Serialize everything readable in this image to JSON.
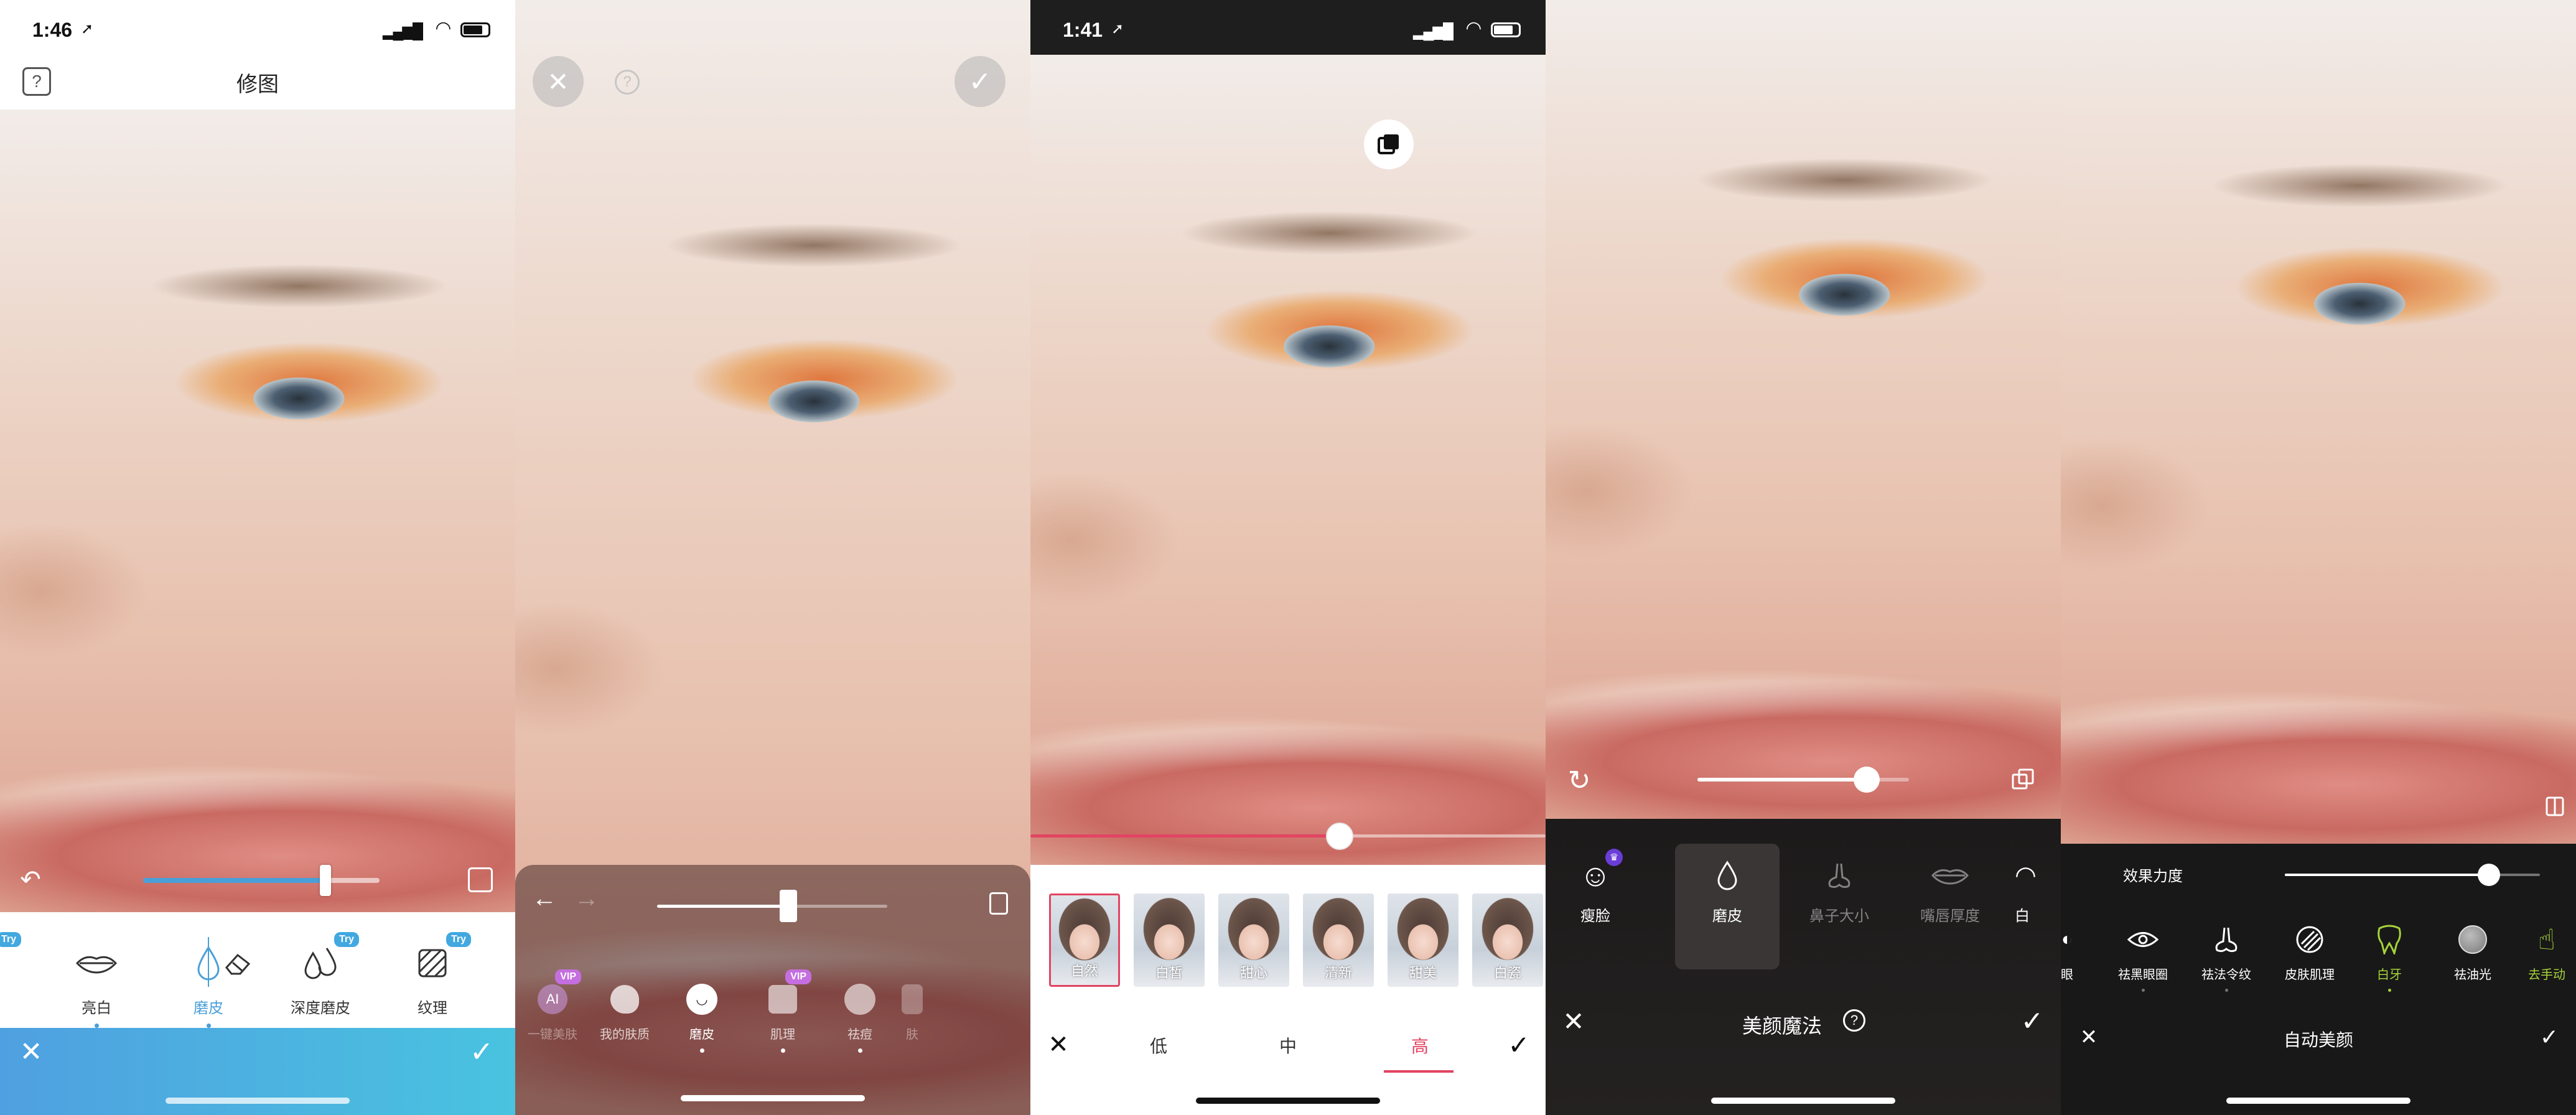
{
  "panel1": {
    "status": {
      "time": "1:46",
      "time_arrow": "➚"
    },
    "header": {
      "title": "修图",
      "help_icon": "?"
    },
    "slider": {
      "value": 0.77
    },
    "tools": [
      {
        "label": "亮白",
        "icon": "lips-icon",
        "try": false
      },
      {
        "label": "磨皮",
        "icon": "droplet-icon",
        "try": false
      },
      {
        "label": "",
        "icon": "eraser-icon",
        "try": false
      },
      {
        "label": "深度磨皮",
        "icon": "double-droplet-icon",
        "try": true
      },
      {
        "label": "纹理",
        "icon": "texture-icon",
        "try": true
      }
    ],
    "try_badge": "Try",
    "try_badge_left": "Try",
    "accent": "#4a9fd8",
    "bottom_gradient": [
      "#4fa0e0",
      "#49c3e0"
    ]
  },
  "panel2": {
    "slider": {
      "value": 0.57
    },
    "tools": [
      {
        "label": "一键美肤",
        "badge": "VIP",
        "icon": "ai-icon",
        "dimmed": true
      },
      {
        "label": "我的肤质",
        "badge": "",
        "icon": "face-profile-icon",
        "dimmed": false
      },
      {
        "label": "磨皮",
        "badge": "",
        "icon": "face-smile-icon",
        "active": true
      },
      {
        "label": "肌理",
        "badge": "VIP",
        "icon": "texture-icon",
        "dimmed": false
      },
      {
        "label": "祛痘",
        "badge": "",
        "icon": "acne-icon",
        "dimmed": false
      },
      {
        "label": "肤",
        "badge": "",
        "icon": "skin-icon",
        "dimmed": true
      }
    ],
    "vip_color": "#c56ee0"
  },
  "panel3": {
    "status": {
      "time": "1:41",
      "time_arrow": "➚"
    },
    "slider": {
      "value": 0.6
    },
    "filters": [
      "自然",
      "白皙",
      "甜心",
      "清新",
      "甜美",
      "白瓷"
    ],
    "levels": [
      "低",
      "中",
      "高"
    ],
    "active_level": "高",
    "accent": "#e24462"
  },
  "panel4": {
    "slider": {
      "value": 0.8
    },
    "tools": [
      {
        "label": "瘦脸",
        "icon": "face-slim-icon",
        "badge": true
      },
      {
        "label": "磨皮",
        "icon": "droplet-icon",
        "active": true
      },
      {
        "label": "鼻子大小",
        "icon": "nose-icon",
        "dimmed": true
      },
      {
        "label": "嘴唇厚度",
        "icon": "lips-icon",
        "dimmed": true
      },
      {
        "label": "白",
        "icon": "tooth-icon",
        "dimmed": false
      }
    ],
    "title": "美颜魔法",
    "help": "?",
    "badge_color": "#6a3dd8"
  },
  "panel5": {
    "slider_label": "效果力度",
    "slider": {
      "value": 0.8
    },
    "tools": [
      {
        "label": "眼",
        "icon": "eye-icon",
        "partial": true
      },
      {
        "label": "祛黑眼圈",
        "icon": "eye-icon"
      },
      {
        "label": "祛法令纹",
        "icon": "nose-icon"
      },
      {
        "label": "皮肤肌理",
        "icon": "texture-circle-icon"
      },
      {
        "label": "白牙",
        "icon": "tooth-icon",
        "active": true
      },
      {
        "label": "祛油光",
        "icon": "gray-circle-icon"
      },
      {
        "label": "去手动",
        "icon": "hand-icon",
        "highlight": true
      }
    ],
    "title": "自动美颜",
    "accent": "#a6d23a"
  }
}
